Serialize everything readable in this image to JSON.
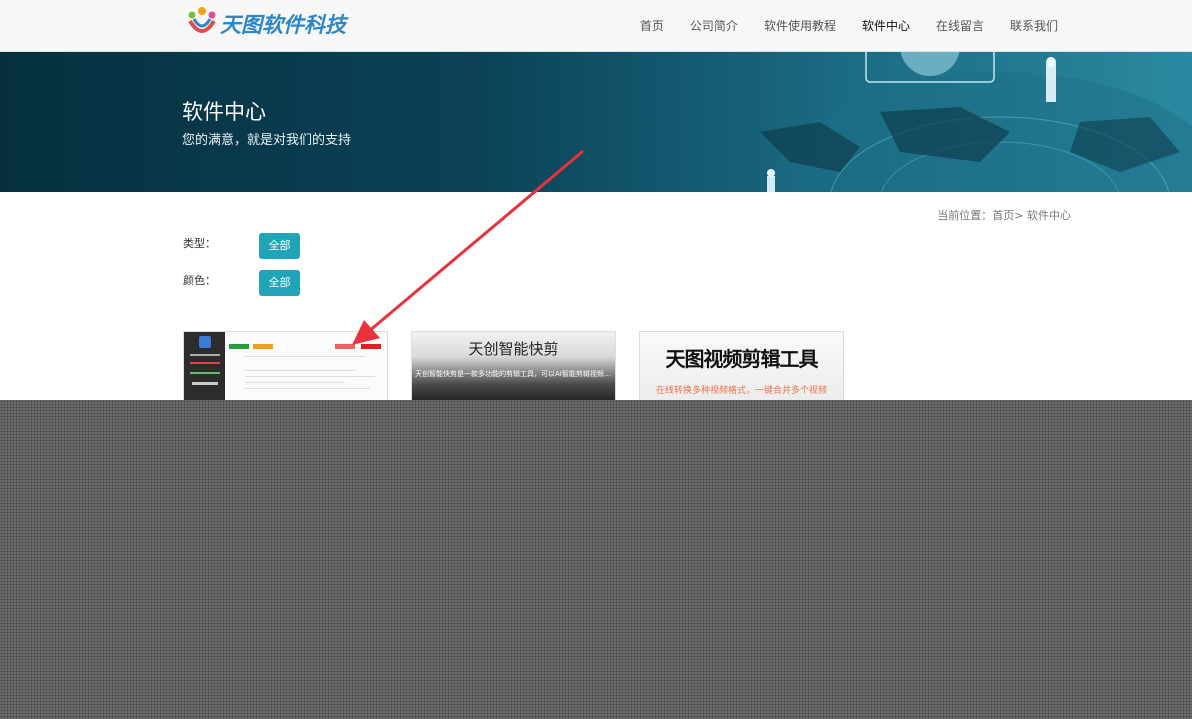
{
  "header": {
    "logo_text": "天图软件科技",
    "nav": [
      {
        "label": "首页",
        "active": false
      },
      {
        "label": "公司简介",
        "active": false
      },
      {
        "label": "软件使用教程",
        "active": false
      },
      {
        "label": "软件中心",
        "active": true
      },
      {
        "label": "在线留言",
        "active": false
      },
      {
        "label": "联系我们",
        "active": false
      }
    ]
  },
  "banner": {
    "title": "软件中心",
    "subtitle": "您的满意，就是对我们的支持"
  },
  "breadcrumb": "当前位置：首页> 软件中心",
  "filters": {
    "type_label": "类型：",
    "type_value": "全部",
    "color_label": "颜色：",
    "color_value": "全部"
  },
  "products": [
    {
      "title": "",
      "desc": ""
    },
    {
      "title": "天创智能快剪",
      "desc": "天创智能快剪是一款多功能的剪辑工具，可以AI智能剪辑视频…"
    },
    {
      "title": "天图视频剪辑工具",
      "desc": "在线转换多种视频格式，一键合并多个视频"
    }
  ],
  "colors": {
    "accent": "#21a4b8",
    "arrow": "#e8323c"
  },
  "icons": {
    "logo": "people-logo-icon"
  }
}
